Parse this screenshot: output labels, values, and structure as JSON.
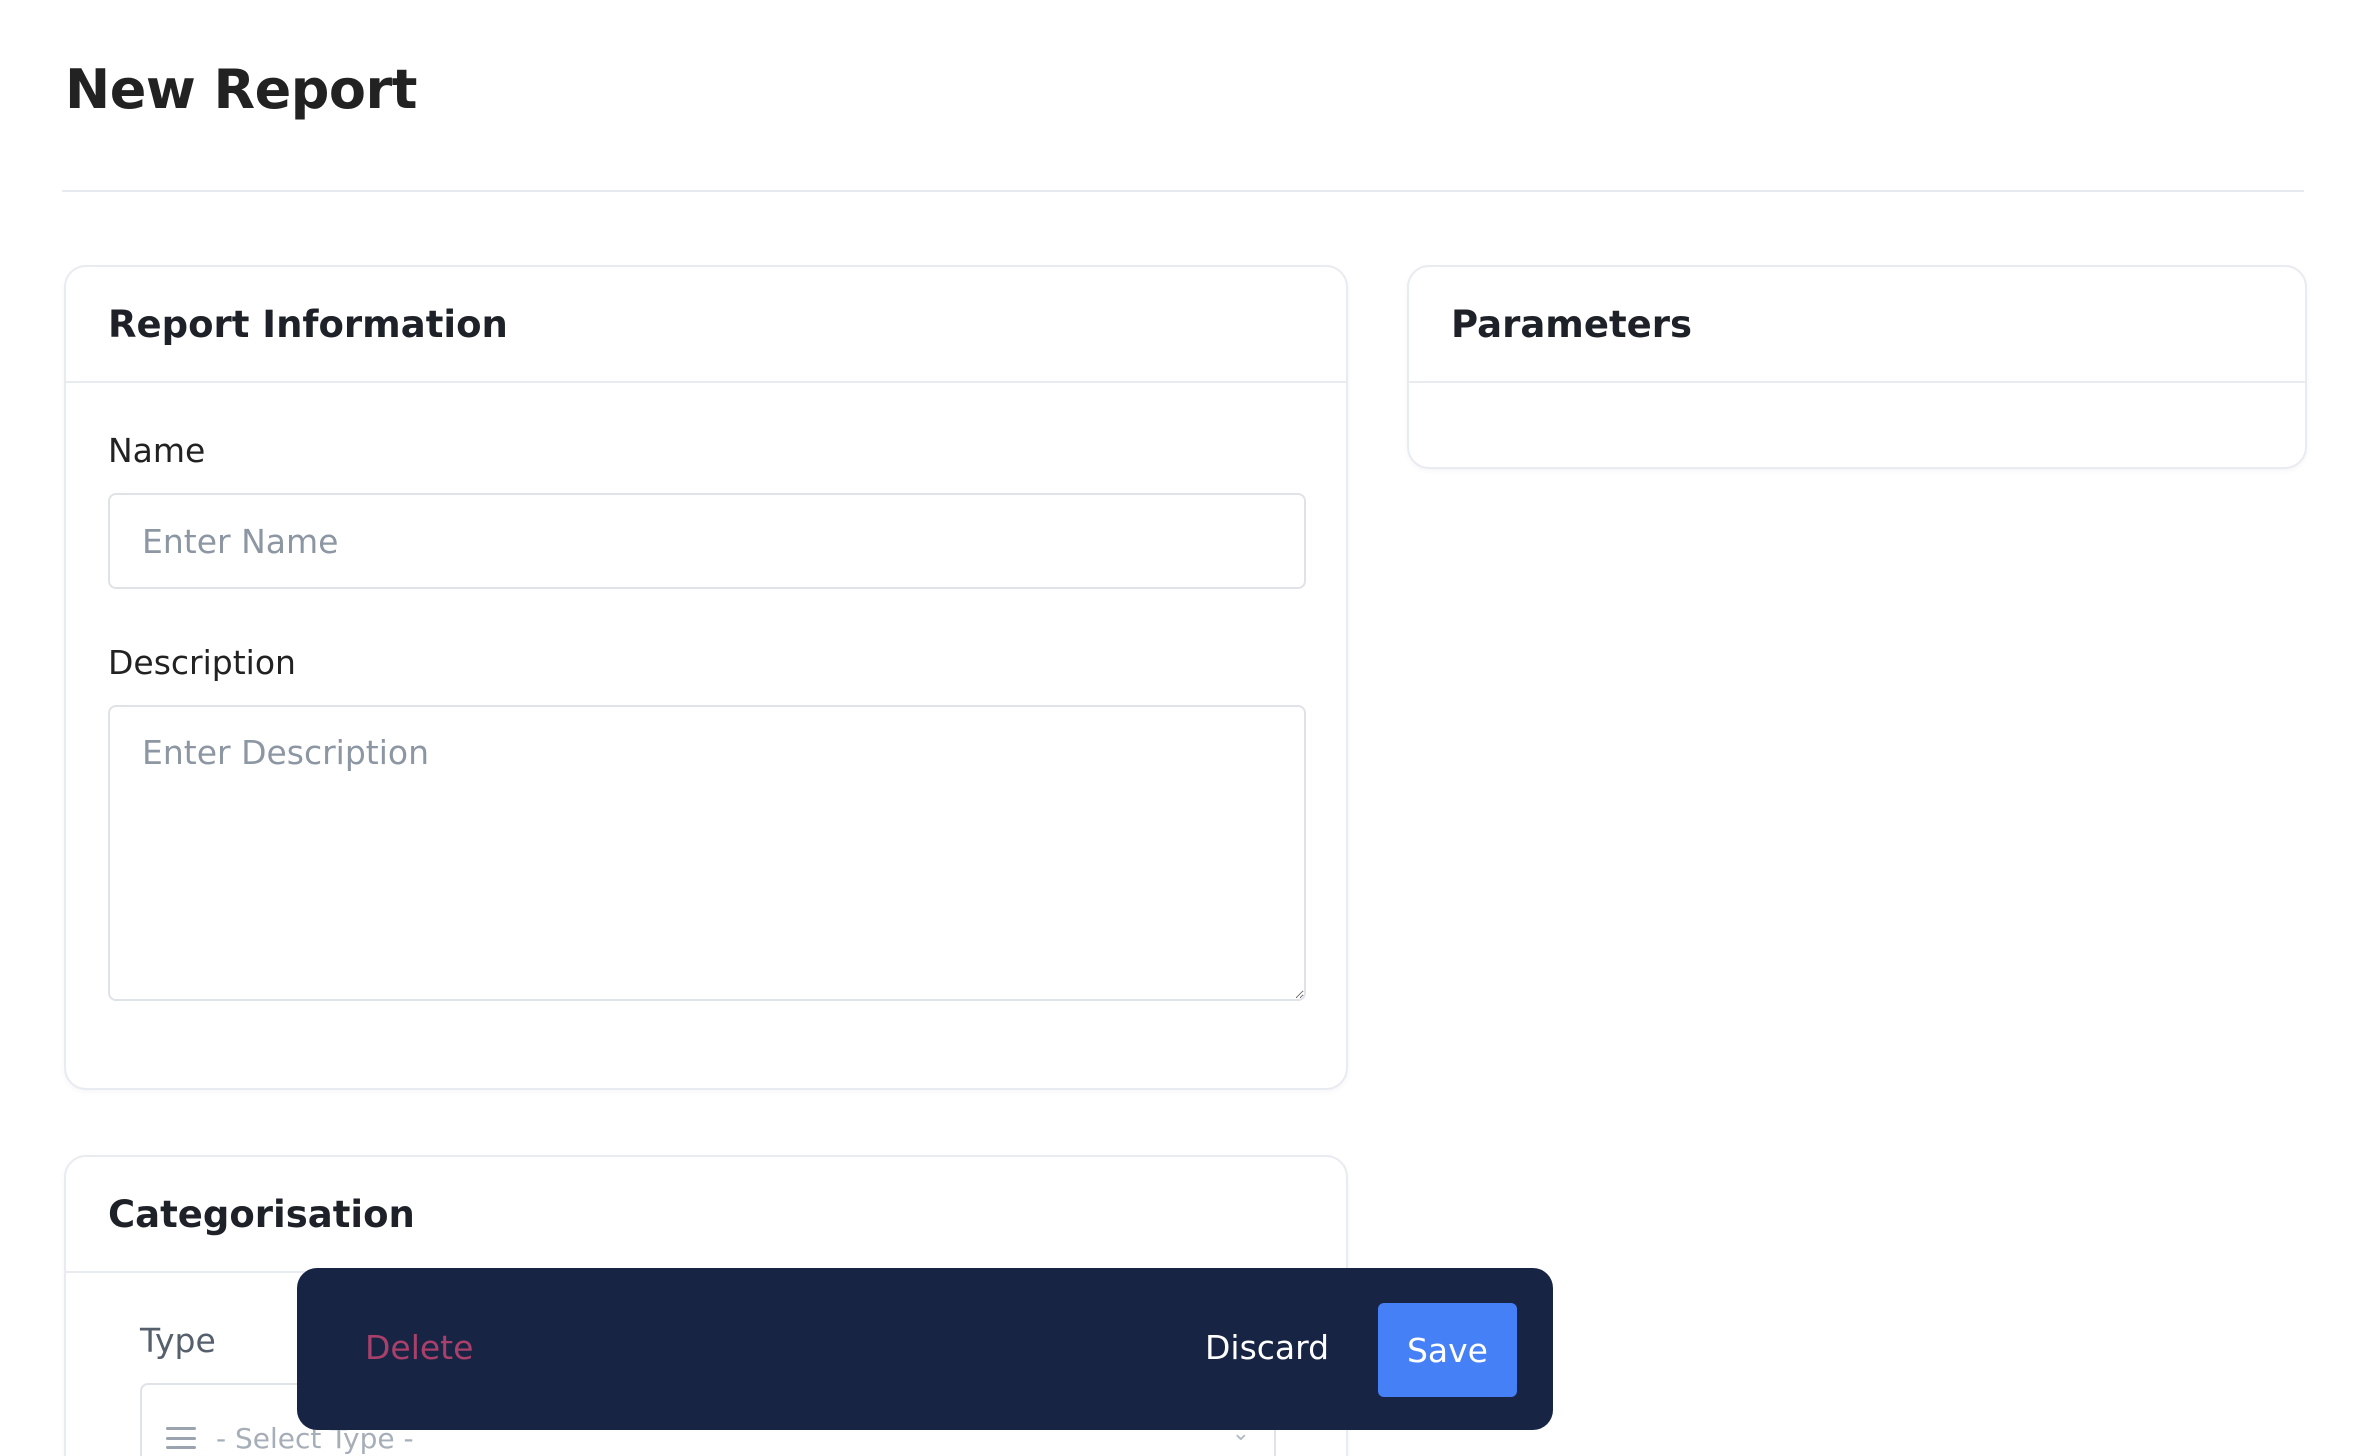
{
  "page": {
    "title": "New Report"
  },
  "report_information": {
    "title": "Report Information",
    "name_label": "Name",
    "name_placeholder": "Enter Name",
    "name_value": "",
    "description_label": "Description",
    "description_placeholder": "Enter Description",
    "description_value": ""
  },
  "parameters": {
    "title": "Parameters"
  },
  "categorisation": {
    "title": "Categorisation",
    "type_label": "Type",
    "type_placeholder": "- Select Type -",
    "type_icon": "list-icon",
    "chevron_icon": "chevron-down-icon"
  },
  "action_bar": {
    "delete_label": "Delete",
    "discard_label": "Discard",
    "save_label": "Save"
  },
  "colors": {
    "action_bar_bg": "#182444",
    "save_button_bg": "#4580f6",
    "delete_text": "#a8406a"
  }
}
